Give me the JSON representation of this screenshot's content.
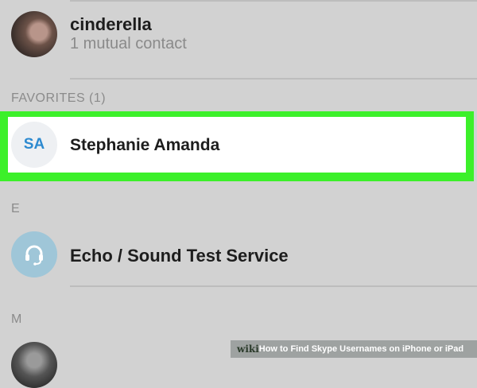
{
  "contacts_top": {
    "name": "cinderella",
    "subtitle": "1 mutual contact"
  },
  "favorites": {
    "header": "FAVORITES (1)",
    "contact": {
      "initials": "SA",
      "name": "Stephanie Amanda"
    }
  },
  "section_e": {
    "header": "E",
    "contact": {
      "name": "Echo / Sound Test Service",
      "icon": "headset-icon"
    }
  },
  "section_m": {
    "header": "M"
  },
  "colors": {
    "background": "#d2d2d2",
    "highlight": "#3cf02a",
    "initials_text": "#2d8ad0",
    "echo_avatar": "#9fc6d8"
  },
  "watermark": {
    "brand": "wiki",
    "how": "How",
    "title": "to Find Skype Usernames on iPhone or iPad"
  }
}
